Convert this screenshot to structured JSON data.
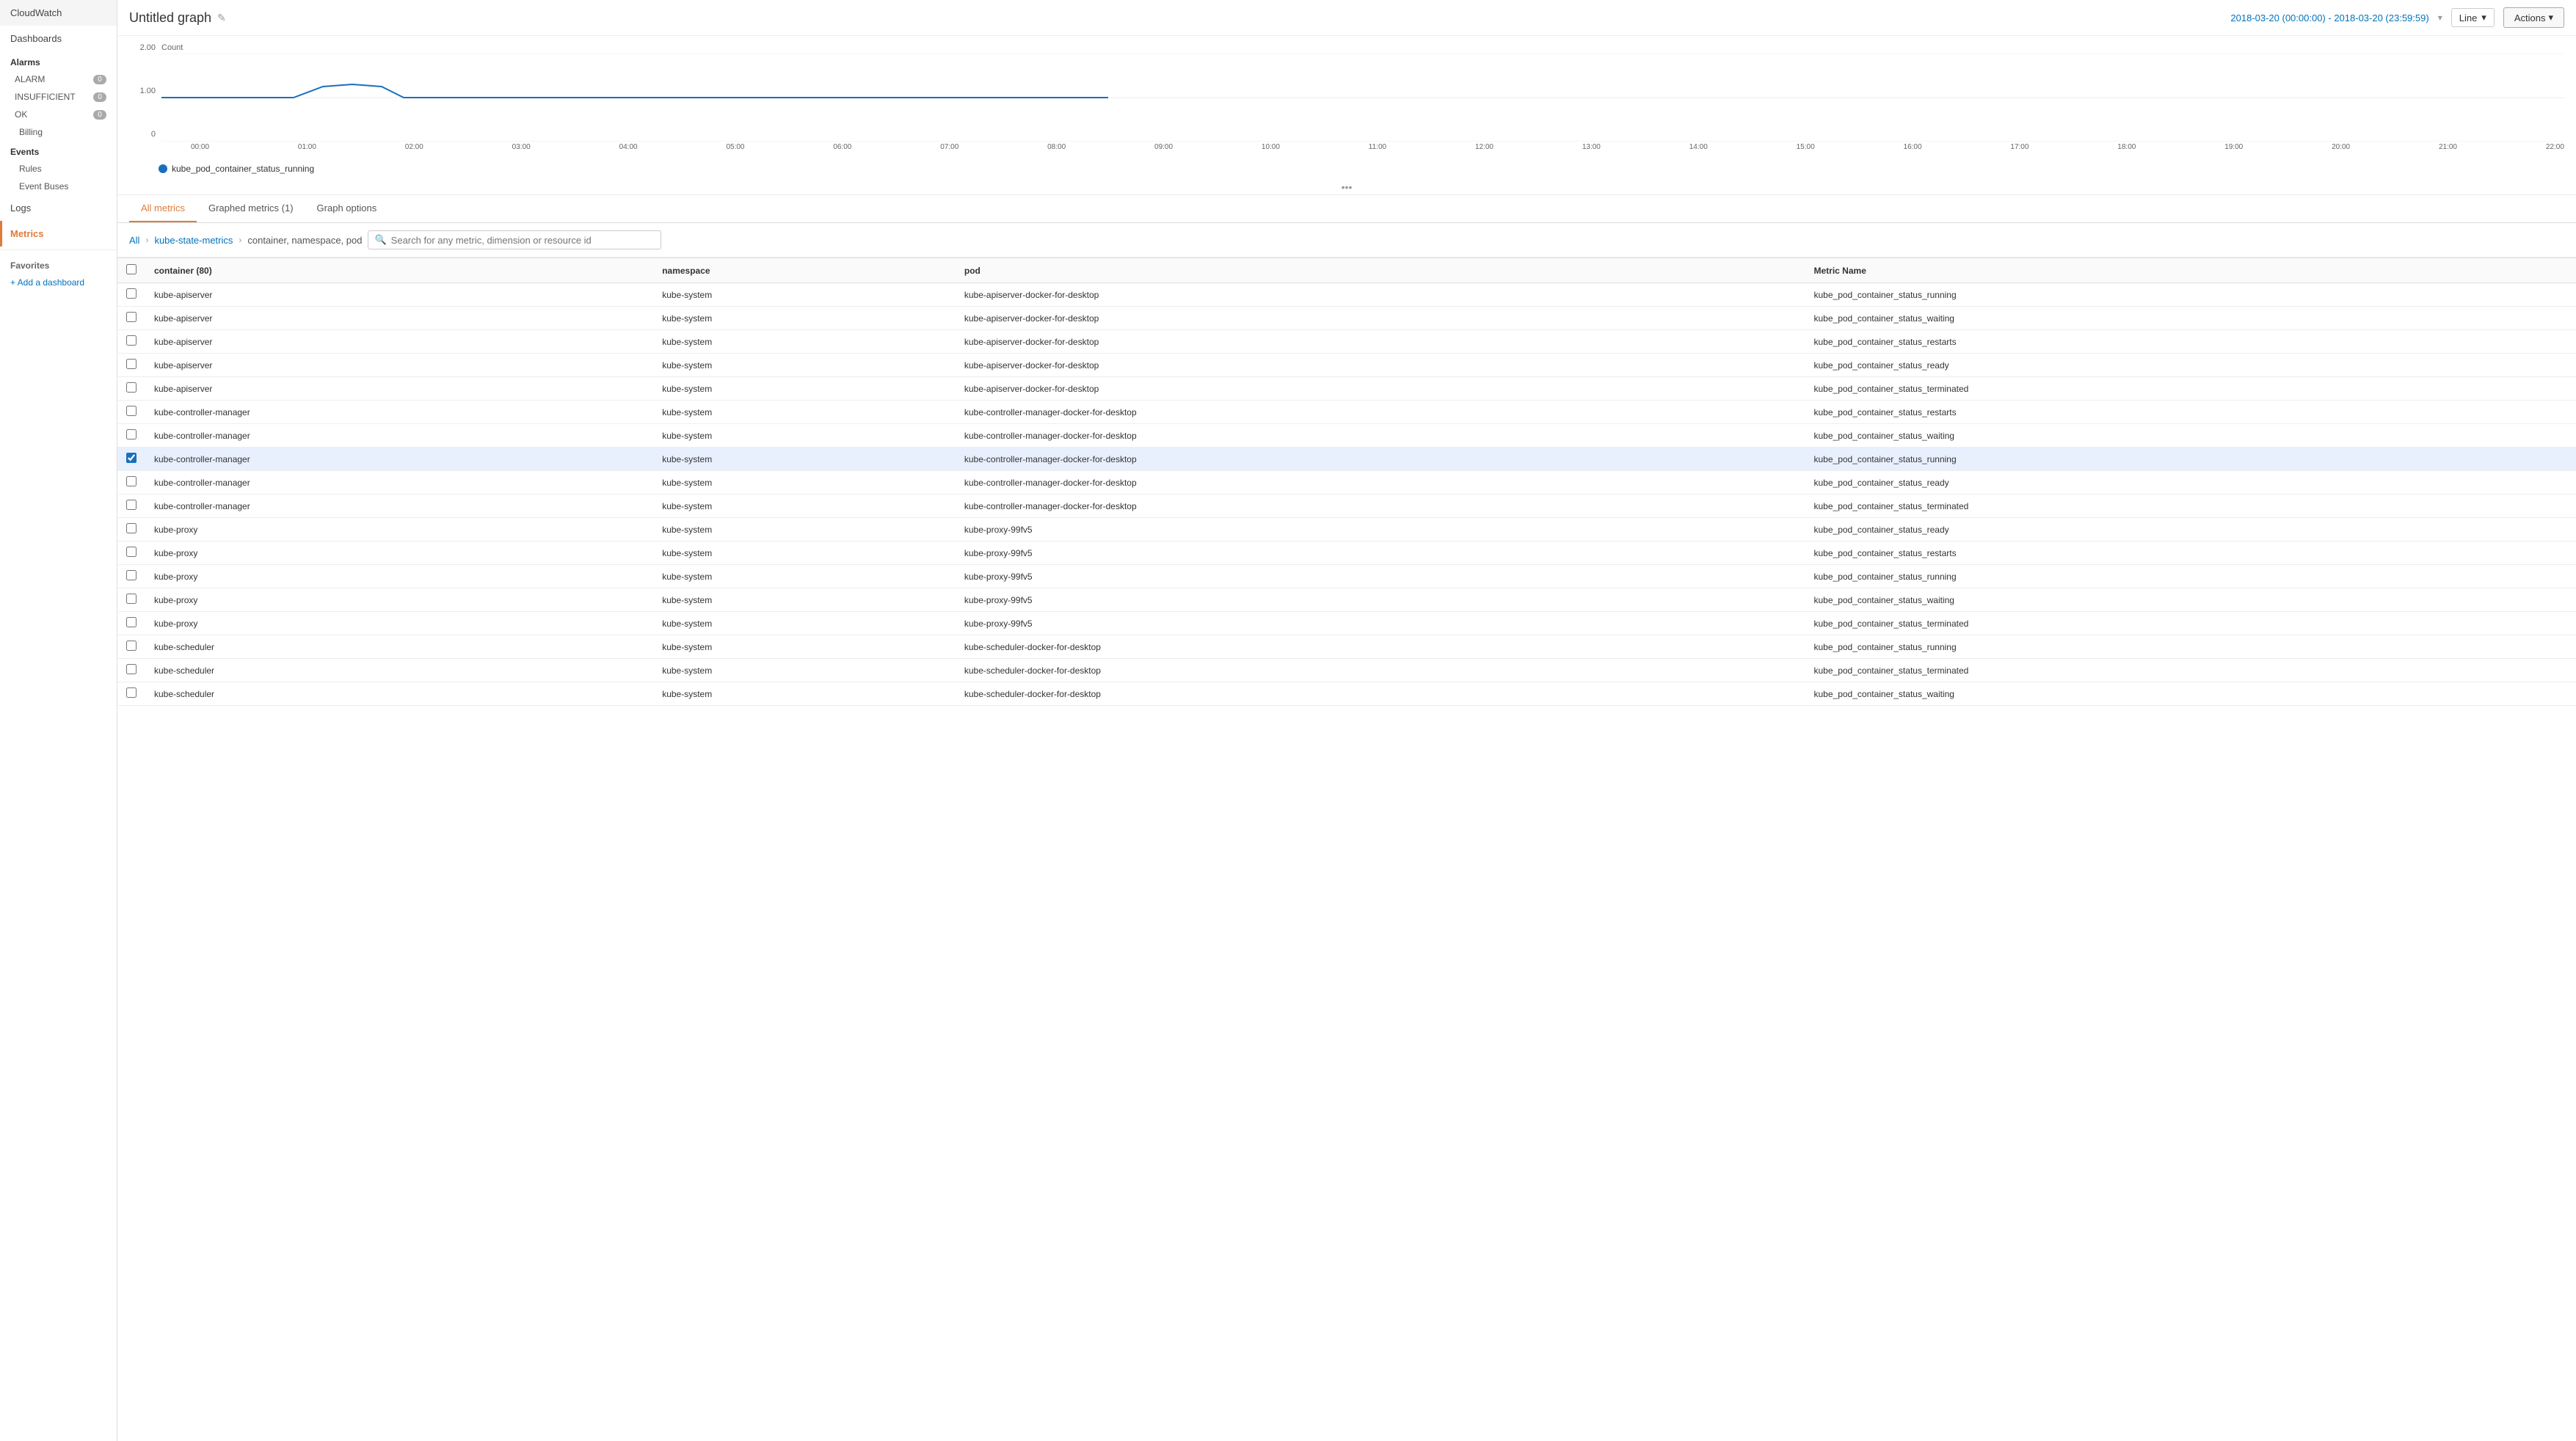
{
  "sidebar": {
    "items": [
      {
        "label": "CloudWatch",
        "id": "cloudwatch"
      },
      {
        "label": "Dashboards",
        "id": "dashboards"
      },
      {
        "label": "Alarms",
        "id": "alarms"
      },
      {
        "label": "ALARM",
        "id": "alarm",
        "badge": "0",
        "sub": true
      },
      {
        "label": "INSUFFICIENT",
        "id": "insufficient",
        "badge": "0",
        "sub": true
      },
      {
        "label": "OK",
        "id": "ok",
        "badge": "0",
        "sub": true
      },
      {
        "label": "Billing",
        "id": "billing"
      },
      {
        "label": "Events",
        "id": "events"
      },
      {
        "label": "Rules",
        "id": "rules",
        "sub": true
      },
      {
        "label": "Event Buses",
        "id": "event-buses",
        "sub": true
      },
      {
        "label": "Logs",
        "id": "logs"
      },
      {
        "label": "Metrics",
        "id": "metrics",
        "active": true
      }
    ],
    "favorites_label": "Favorites",
    "add_dashboard_label": "+ Add a dashboard"
  },
  "topbar": {
    "title": "Untitled graph",
    "date_range": "2018-03-20 (00:00:00) - 2018-03-20 (23:59:59)",
    "chart_type": "Line",
    "actions_label": "Actions"
  },
  "chart": {
    "y_max": "2.00",
    "y_mid": "1.00",
    "y_min": "0",
    "x_labels": [
      "00:00",
      "01:00",
      "02:00",
      "03:00",
      "04:00",
      "05:00",
      "06:00",
      "07:00",
      "08:00",
      "09:00",
      "10:00",
      "11:00",
      "12:00",
      "13:00",
      "14:00",
      "15:00",
      "16:00",
      "17:00",
      "18:00",
      "19:00",
      "20:00",
      "21:00",
      "22:00"
    ],
    "legend": "kube_pod_container_status_running",
    "legend_color": "#1a6fbd",
    "y_axis_label": "Count"
  },
  "tabs": [
    {
      "label": "All metrics",
      "id": "all-metrics",
      "active": true
    },
    {
      "label": "Graphed metrics (1)",
      "id": "graphed-metrics"
    },
    {
      "label": "Graph options",
      "id": "graph-options"
    }
  ],
  "breadcrumb": {
    "all": "All",
    "source": "kube-state-metrics",
    "dimensions": "container, namespace, pod"
  },
  "search": {
    "placeholder": "Search for any metric, dimension or resource id"
  },
  "table": {
    "columns": [
      "container (80)",
      "namespace",
      "pod",
      "Metric Name"
    ],
    "rows": [
      {
        "container": "kube-apiserver",
        "namespace": "kube-system",
        "pod": "kube-apiserver-docker-for-desktop",
        "metric": "kube_pod_container_status_running",
        "selected": false
      },
      {
        "container": "kube-apiserver",
        "namespace": "kube-system",
        "pod": "kube-apiserver-docker-for-desktop",
        "metric": "kube_pod_container_status_waiting",
        "selected": false
      },
      {
        "container": "kube-apiserver",
        "namespace": "kube-system",
        "pod": "kube-apiserver-docker-for-desktop",
        "metric": "kube_pod_container_status_restarts",
        "selected": false
      },
      {
        "container": "kube-apiserver",
        "namespace": "kube-system",
        "pod": "kube-apiserver-docker-for-desktop",
        "metric": "kube_pod_container_status_ready",
        "selected": false
      },
      {
        "container": "kube-apiserver",
        "namespace": "kube-system",
        "pod": "kube-apiserver-docker-for-desktop",
        "metric": "kube_pod_container_status_terminated",
        "selected": false
      },
      {
        "container": "kube-controller-manager",
        "namespace": "kube-system",
        "pod": "kube-controller-manager-docker-for-desktop",
        "metric": "kube_pod_container_status_restarts",
        "selected": false
      },
      {
        "container": "kube-controller-manager",
        "namespace": "kube-system",
        "pod": "kube-controller-manager-docker-for-desktop",
        "metric": "kube_pod_container_status_waiting",
        "selected": false
      },
      {
        "container": "kube-controller-manager",
        "namespace": "kube-system",
        "pod": "kube-controller-manager-docker-for-desktop",
        "metric": "kube_pod_container_status_running",
        "selected": true
      },
      {
        "container": "kube-controller-manager",
        "namespace": "kube-system",
        "pod": "kube-controller-manager-docker-for-desktop",
        "metric": "kube_pod_container_status_ready",
        "selected": false
      },
      {
        "container": "kube-controller-manager",
        "namespace": "kube-system",
        "pod": "kube-controller-manager-docker-for-desktop",
        "metric": "kube_pod_container_status_terminated",
        "selected": false
      },
      {
        "container": "kube-proxy",
        "namespace": "kube-system",
        "pod": "kube-proxy-99fv5",
        "metric": "kube_pod_container_status_ready",
        "selected": false
      },
      {
        "container": "kube-proxy",
        "namespace": "kube-system",
        "pod": "kube-proxy-99fv5",
        "metric": "kube_pod_container_status_restarts",
        "selected": false
      },
      {
        "container": "kube-proxy",
        "namespace": "kube-system",
        "pod": "kube-proxy-99fv5",
        "metric": "kube_pod_container_status_running",
        "selected": false
      },
      {
        "container": "kube-proxy",
        "namespace": "kube-system",
        "pod": "kube-proxy-99fv5",
        "metric": "kube_pod_container_status_waiting",
        "selected": false
      },
      {
        "container": "kube-proxy",
        "namespace": "kube-system",
        "pod": "kube-proxy-99fv5",
        "metric": "kube_pod_container_status_terminated",
        "selected": false
      },
      {
        "container": "kube-scheduler",
        "namespace": "kube-system",
        "pod": "kube-scheduler-docker-for-desktop",
        "metric": "kube_pod_container_status_running",
        "selected": false
      },
      {
        "container": "kube-scheduler",
        "namespace": "kube-system",
        "pod": "kube-scheduler-docker-for-desktop",
        "metric": "kube_pod_container_status_terminated",
        "selected": false
      },
      {
        "container": "kube-scheduler",
        "namespace": "kube-system",
        "pod": "kube-scheduler-docker-for-desktop",
        "metric": "kube_pod_container_status_waiting",
        "selected": false
      }
    ]
  }
}
